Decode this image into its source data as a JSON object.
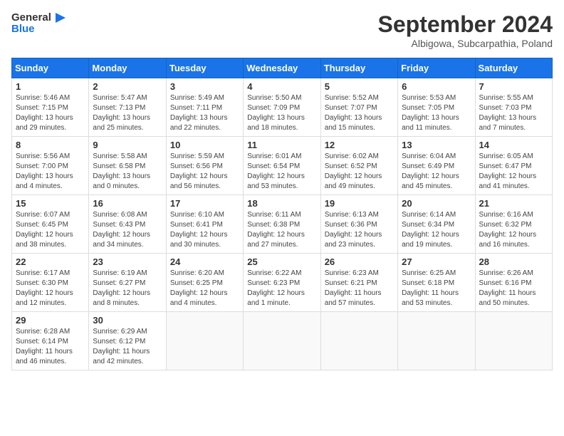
{
  "header": {
    "logo_general": "General",
    "logo_blue": "Blue",
    "month_title": "September 2024",
    "subtitle": "Albigowa, Subcarpathia, Poland"
  },
  "weekdays": [
    "Sunday",
    "Monday",
    "Tuesday",
    "Wednesday",
    "Thursday",
    "Friday",
    "Saturday"
  ],
  "weeks": [
    [
      {
        "day": "1",
        "info": "Sunrise: 5:46 AM\nSunset: 7:15 PM\nDaylight: 13 hours\nand 29 minutes."
      },
      {
        "day": "2",
        "info": "Sunrise: 5:47 AM\nSunset: 7:13 PM\nDaylight: 13 hours\nand 25 minutes."
      },
      {
        "day": "3",
        "info": "Sunrise: 5:49 AM\nSunset: 7:11 PM\nDaylight: 13 hours\nand 22 minutes."
      },
      {
        "day": "4",
        "info": "Sunrise: 5:50 AM\nSunset: 7:09 PM\nDaylight: 13 hours\nand 18 minutes."
      },
      {
        "day": "5",
        "info": "Sunrise: 5:52 AM\nSunset: 7:07 PM\nDaylight: 13 hours\nand 15 minutes."
      },
      {
        "day": "6",
        "info": "Sunrise: 5:53 AM\nSunset: 7:05 PM\nDaylight: 13 hours\nand 11 minutes."
      },
      {
        "day": "7",
        "info": "Sunrise: 5:55 AM\nSunset: 7:03 PM\nDaylight: 13 hours\nand 7 minutes."
      }
    ],
    [
      {
        "day": "8",
        "info": "Sunrise: 5:56 AM\nSunset: 7:00 PM\nDaylight: 13 hours\nand 4 minutes."
      },
      {
        "day": "9",
        "info": "Sunrise: 5:58 AM\nSunset: 6:58 PM\nDaylight: 13 hours\nand 0 minutes."
      },
      {
        "day": "10",
        "info": "Sunrise: 5:59 AM\nSunset: 6:56 PM\nDaylight: 12 hours\nand 56 minutes."
      },
      {
        "day": "11",
        "info": "Sunrise: 6:01 AM\nSunset: 6:54 PM\nDaylight: 12 hours\nand 53 minutes."
      },
      {
        "day": "12",
        "info": "Sunrise: 6:02 AM\nSunset: 6:52 PM\nDaylight: 12 hours\nand 49 minutes."
      },
      {
        "day": "13",
        "info": "Sunrise: 6:04 AM\nSunset: 6:49 PM\nDaylight: 12 hours\nand 45 minutes."
      },
      {
        "day": "14",
        "info": "Sunrise: 6:05 AM\nSunset: 6:47 PM\nDaylight: 12 hours\nand 41 minutes."
      }
    ],
    [
      {
        "day": "15",
        "info": "Sunrise: 6:07 AM\nSunset: 6:45 PM\nDaylight: 12 hours\nand 38 minutes."
      },
      {
        "day": "16",
        "info": "Sunrise: 6:08 AM\nSunset: 6:43 PM\nDaylight: 12 hours\nand 34 minutes."
      },
      {
        "day": "17",
        "info": "Sunrise: 6:10 AM\nSunset: 6:41 PM\nDaylight: 12 hours\nand 30 minutes."
      },
      {
        "day": "18",
        "info": "Sunrise: 6:11 AM\nSunset: 6:38 PM\nDaylight: 12 hours\nand 27 minutes."
      },
      {
        "day": "19",
        "info": "Sunrise: 6:13 AM\nSunset: 6:36 PM\nDaylight: 12 hours\nand 23 minutes."
      },
      {
        "day": "20",
        "info": "Sunrise: 6:14 AM\nSunset: 6:34 PM\nDaylight: 12 hours\nand 19 minutes."
      },
      {
        "day": "21",
        "info": "Sunrise: 6:16 AM\nSunset: 6:32 PM\nDaylight: 12 hours\nand 16 minutes."
      }
    ],
    [
      {
        "day": "22",
        "info": "Sunrise: 6:17 AM\nSunset: 6:30 PM\nDaylight: 12 hours\nand 12 minutes."
      },
      {
        "day": "23",
        "info": "Sunrise: 6:19 AM\nSunset: 6:27 PM\nDaylight: 12 hours\nand 8 minutes."
      },
      {
        "day": "24",
        "info": "Sunrise: 6:20 AM\nSunset: 6:25 PM\nDaylight: 12 hours\nand 4 minutes."
      },
      {
        "day": "25",
        "info": "Sunrise: 6:22 AM\nSunset: 6:23 PM\nDaylight: 12 hours\nand 1 minute."
      },
      {
        "day": "26",
        "info": "Sunrise: 6:23 AM\nSunset: 6:21 PM\nDaylight: 11 hours\nand 57 minutes."
      },
      {
        "day": "27",
        "info": "Sunrise: 6:25 AM\nSunset: 6:18 PM\nDaylight: 11 hours\nand 53 minutes."
      },
      {
        "day": "28",
        "info": "Sunrise: 6:26 AM\nSunset: 6:16 PM\nDaylight: 11 hours\nand 50 minutes."
      }
    ],
    [
      {
        "day": "29",
        "info": "Sunrise: 6:28 AM\nSunset: 6:14 PM\nDaylight: 11 hours\nand 46 minutes."
      },
      {
        "day": "30",
        "info": "Sunrise: 6:29 AM\nSunset: 6:12 PM\nDaylight: 11 hours\nand 42 minutes."
      },
      null,
      null,
      null,
      null,
      null
    ]
  ]
}
